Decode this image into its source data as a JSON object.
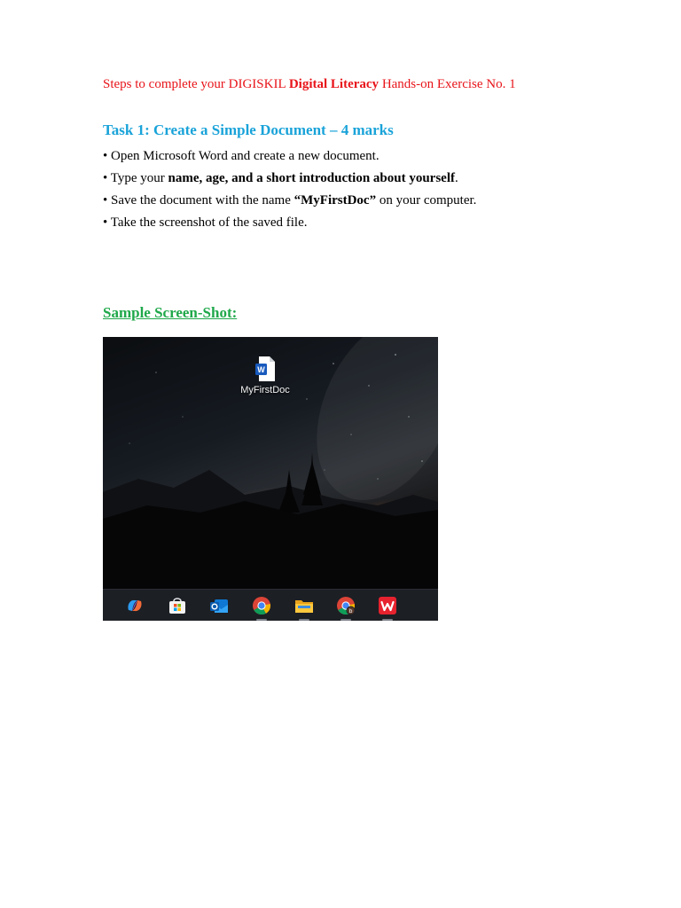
{
  "intro": {
    "prefix": "Steps to complete your DIGISKIL ",
    "bold": "Digital Literacy",
    "suffix": " Hands-on Exercise No. 1"
  },
  "task": {
    "title": "Task 1: Create a Simple Document – 4 marks",
    "bullet1": "• Open Microsoft Word and create a new document.",
    "bullet2_prefix": "• Type your ",
    "bullet2_bold": "name, age, and a short introduction about yourself",
    "bullet2_suffix": ".",
    "bullet3_prefix": "• Save the document with the name ",
    "bullet3_bold": "“MyFirstDoc”",
    "bullet3_suffix": " on your computer.",
    "bullet4": "• Take the screenshot of the saved file."
  },
  "sample": {
    "title": "Sample Screen-Shot:",
    "desktop_icon_label": "MyFirstDoc",
    "desktop_icon": "word-document-icon",
    "taskbar_icons": [
      "copilot-icon",
      "microsoft-store-icon",
      "outlook-icon",
      "chrome-icon",
      "file-explorer-icon",
      "chrome-profile-icon",
      "wps-office-icon"
    ],
    "profile_badge": "b",
    "word_letter": "W"
  },
  "colors": {
    "intro_red": "#e8141a",
    "task_blue": "#1aa3d9",
    "sample_green": "#1fa84a"
  }
}
